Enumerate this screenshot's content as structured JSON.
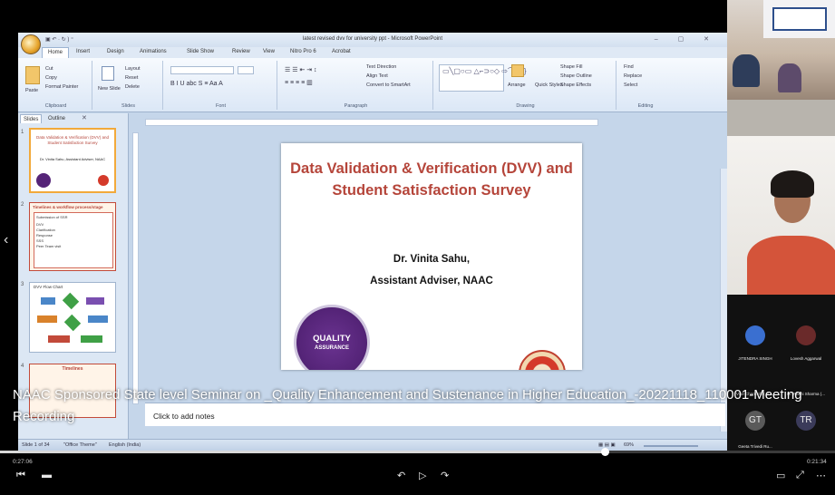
{
  "powerpoint": {
    "window_title": "latest revised dvv for university ppt - Microsoft PowerPoint",
    "quick_access": "▣ ↶ · ↻ ) ⁼",
    "tabs": [
      "Home",
      "Insert",
      "Design",
      "Animations",
      "Slide Show",
      "Review",
      "View",
      "Nitro Pro 6",
      "Acrobat"
    ],
    "ribbon": {
      "clipboard": {
        "paste": "Paste",
        "cut": "Cut",
        "copy": "Copy",
        "format_painter": "Format Painter",
        "label": "Clipboard"
      },
      "slides": {
        "new_slide": "New Slide",
        "layout": "Layout",
        "reset": "Reset",
        "delete": "Delete",
        "label": "Slides"
      },
      "font": {
        "label": "Font"
      },
      "paragraph": {
        "text_direction": "Text Direction",
        "align_text": "Align Text",
        "convert_smartart": "Convert to SmartArt",
        "label": "Paragraph"
      },
      "drawing": {
        "arrange": "Arrange",
        "quick_styles": "Quick Styles",
        "shape_fill": "Shape Fill",
        "shape_outline": "Shape Outline",
        "shape_effects": "Shape Effects",
        "label": "Drawing"
      },
      "editing": {
        "find": "Find",
        "replace": "Replace",
        "select": "Select",
        "label": "Editing"
      }
    },
    "pane_tabs": [
      "Slides",
      "Outline"
    ],
    "thumbnails": [
      {
        "num": "1",
        "title": "Data Validation & Verification (DVV) and Student Satisfaction Survey",
        "sub": "Dr. Vinita Sahu, Assistant Adviser, NAAC"
      },
      {
        "num": "2",
        "title": "Timelines & workflow process/stage",
        "lines": [
          "Submission of SSR",
          "DVV",
          "Clarification",
          "Response",
          "SSS",
          "Peer Team visit"
        ]
      },
      {
        "num": "3",
        "title": "DVV Flow Chart"
      },
      {
        "num": "4",
        "title": "Timelines"
      }
    ],
    "slide": {
      "title": "Data Validation & Verification (DVV) and Student Satisfaction Survey",
      "presenter": "Dr. Vinita Sahu,",
      "role": "Assistant Adviser, NAAC",
      "logo_line1": "QUALITY",
      "logo_line2": "ASSURANCE"
    },
    "notes_placeholder": "Click to add notes",
    "status": {
      "slide_of": "Slide 1 of 34",
      "theme": "\"Office Theme\"",
      "language": "English (India)",
      "zoom": "69%"
    }
  },
  "meeting": {
    "participants": [
      {
        "name": "JITENDRA SINGH",
        "type": "video"
      },
      {
        "name": "Lovesh Aggarwal",
        "type": "video"
      },
      {
        "name": "Vice Chancellor, IU...",
        "type": "video"
      },
      {
        "name": "Dr. Rakhi Sharma (...",
        "type": "video"
      },
      {
        "name": "Geeta Trivedi Ru...",
        "initials": "GT",
        "type": "avatar"
      },
      {
        "name": "",
        "initials": "TR",
        "type": "avatar"
      }
    ],
    "caption": "NAAC Sponsored State level Seminar on _Quality Enhancement and Sustenance in Higher Education_-20221118_110001-Meeting Recording",
    "player": {
      "elapsed": "0:27:06",
      "duration": "0:21:34",
      "progress": 0.724,
      "left_controls": [
        "⏮",
        "▬"
      ],
      "center_controls": [
        "↶",
        "▷",
        "↷"
      ],
      "right_controls": [
        "▭",
        "⤢",
        "⋯"
      ]
    }
  }
}
